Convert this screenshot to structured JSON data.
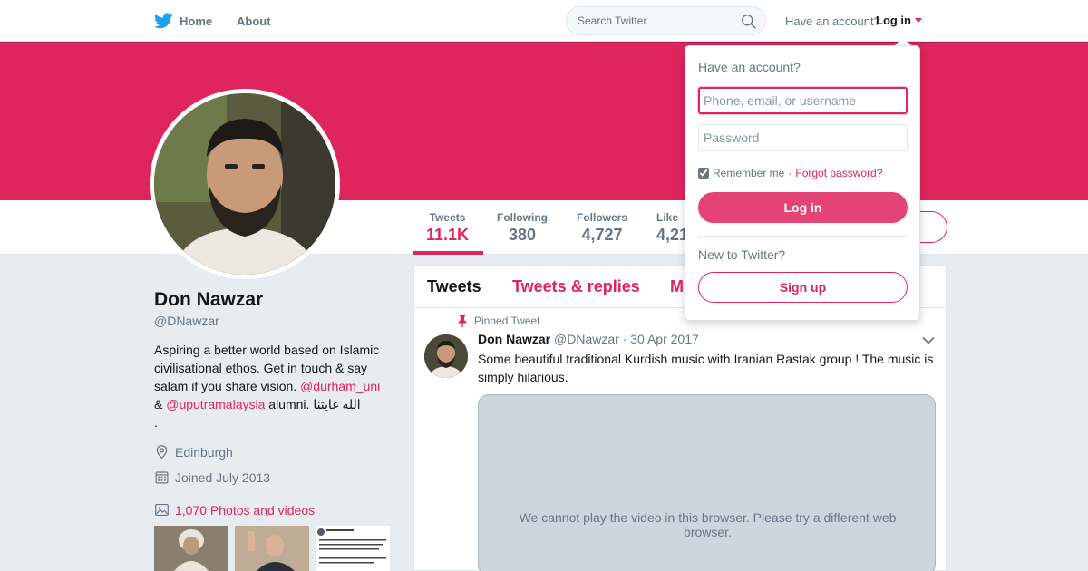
{
  "nav": {
    "home_label": "Home",
    "about_label": "About",
    "search_placeholder": "Search Twitter",
    "have_account_text": "Have an account?",
    "login_label": "Log in"
  },
  "profile": {
    "name": "Don Nawzar",
    "handle": "@DNawzar",
    "bio_1": "Aspiring a better world based on Islamic civilisational ethos. Get in touch & say salam if you share vision. ",
    "bio_mention_1": "@durham_uni",
    "bio_2": " & ",
    "bio_mention_2": "@uputramalaysia",
    "bio_3": " alumni. ",
    "bio_arabic": "الله غايتنا",
    "bio_end": " .",
    "location": "Edinburgh",
    "joined": "Joined July 2013",
    "photos": "1,070 Photos and videos"
  },
  "stats": [
    {
      "label": "Tweets",
      "value": "11.1K",
      "active": true
    },
    {
      "label": "Following",
      "value": "380"
    },
    {
      "label": "Followers",
      "value": "4,727"
    },
    {
      "label": "Likes",
      "value": "4,21"
    }
  ],
  "stat_likes_label": "Like",
  "timeline": {
    "tabs": [
      "Tweets",
      "Tweets & replies",
      "M"
    ],
    "pinned_label": "Pinned Tweet",
    "tweet": {
      "name": "Don Nawzar",
      "handle": "@DNawzar",
      "separator": "·",
      "date": "30 Apr 2017",
      "text": "Some beautiful traditional Kurdish music with Iranian Rastak group ! The music is simply hilarious.",
      "video_message": "We cannot play the video in this browser. Please try a different web browser."
    }
  },
  "login_dropdown": {
    "title": "Have an account?",
    "username_placeholder": "Phone, email, or username",
    "password_placeholder": "Password",
    "remember_me": "Remember me",
    "separator": "·",
    "forgot_password": "Forgot password?",
    "login_button": "Log in",
    "new_text": "New to Twitter?",
    "signup_button": "Sign up"
  },
  "colors": {
    "accent": "#e0245e",
    "background": "#e6ecf0",
    "twitter_blue": "#1da1f2"
  },
  "icons": [
    "twitter-bird-icon",
    "search-icon",
    "caret-down-icon",
    "location-icon",
    "calendar-icon",
    "photos-icon",
    "pin-icon",
    "chevron-down-icon"
  ]
}
